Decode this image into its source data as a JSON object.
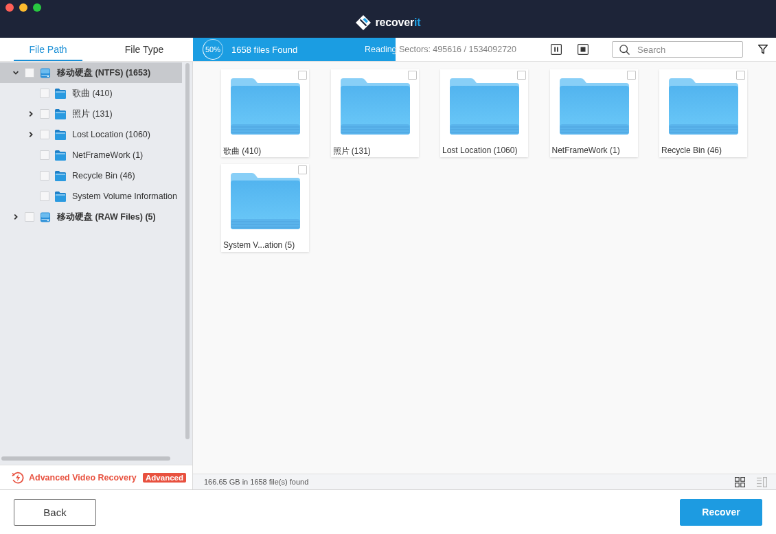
{
  "logo": {
    "name": "recover",
    "accent": "it"
  },
  "sidebar": {
    "tabs": [
      {
        "label": "File Path",
        "selected": true
      },
      {
        "label": "File Type",
        "selected": false
      }
    ],
    "tree": [
      {
        "kind": "drive",
        "label": "移动硬盘 (NTFS) (1653)",
        "expanded": true,
        "selected": true,
        "checked": false,
        "children": [
          {
            "kind": "folder",
            "label": "歌曲 (410)",
            "selected": false,
            "checked": false
          },
          {
            "kind": "folder",
            "label": "照片 (131)",
            "expanded": false,
            "selected": false,
            "checked": false
          },
          {
            "kind": "folder",
            "label": "Lost Location (1060)",
            "expanded": false,
            "selected": false,
            "checked": false
          },
          {
            "kind": "folder",
            "label": "NetFrameWork (1)",
            "selected": false,
            "checked": false
          },
          {
            "kind": "folder",
            "label": "Recycle Bin (46)",
            "selected": false,
            "checked": false
          },
          {
            "kind": "folder",
            "label": "System Volume Information",
            "selected": false,
            "checked": false
          }
        ]
      },
      {
        "kind": "drive",
        "label": "移动硬盘 (RAW Files) (5)",
        "expanded": false,
        "selected": false,
        "checked": false
      }
    ],
    "promo": {
      "label": "Advanced Video Recovery",
      "badge": "Advanced"
    }
  },
  "scan": {
    "percent": "50%",
    "found": "1658 files Found",
    "reading": "Reading Sectors: 495616 / 1534092720",
    "level": 0.348
  },
  "search": {
    "placeholder": "Search"
  },
  "grid": {
    "items": [
      {
        "label": "歌曲 (410)",
        "checked": false
      },
      {
        "label": "照片 (131)",
        "checked": false
      },
      {
        "label": "Lost Location (1060)",
        "checked": false
      },
      {
        "label": "NetFrameWork (1)",
        "checked": false
      },
      {
        "label": "Recycle Bin (46)",
        "checked": false
      },
      {
        "label": "System V...ation (5)",
        "checked": false
      }
    ]
  },
  "status_bar": {
    "summary": "166.65 GB in 1658 file(s) found",
    "views": [
      {
        "kind": "grid",
        "selected": true
      },
      {
        "kind": "list",
        "selected": false
      }
    ]
  },
  "buttons": [
    {
      "kind": "secondary",
      "label": "Back"
    },
    {
      "kind": "primary",
      "label": "Recover"
    }
  ]
}
